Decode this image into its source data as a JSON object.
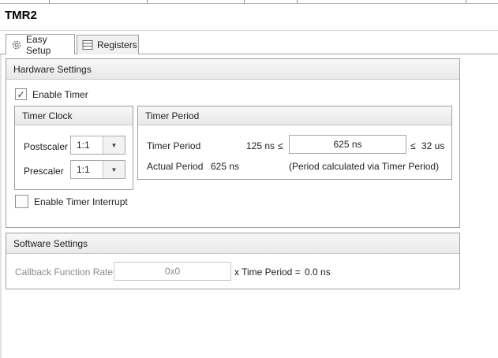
{
  "window": {
    "title": "TMR2"
  },
  "tabs": [
    {
      "label": "Easy Setup",
      "icon": "gear-icon",
      "active": true
    },
    {
      "label": "Registers",
      "icon": "register-table-icon",
      "active": false
    }
  ],
  "hardware": {
    "header": "Hardware Settings",
    "enable_timer": {
      "label": "Enable Timer",
      "checked": true,
      "mark": "✓"
    },
    "timer_clock": {
      "header": "Timer Clock",
      "postscaler": {
        "label": "Postscaler",
        "value": "1:1"
      },
      "prescaler": {
        "label": "Prescaler",
        "value": "1:1"
      }
    },
    "timer_period": {
      "header": "Timer Period",
      "label": "Timer Period",
      "min": "125 ns",
      "le_left": "≤",
      "value": "625 ns",
      "le_right": "≤",
      "max": "32 us",
      "actual_label": "Actual Period",
      "actual_value": "625 ns",
      "note": "(Period calculated via Timer Period)"
    },
    "enable_interrupt": {
      "label": "Enable Timer Interrupt",
      "checked": false
    }
  },
  "software": {
    "header": "Software Settings",
    "callback_label": "Callback Function Rate",
    "callback_value": "0x0",
    "suffix": "x Time Period =",
    "result": "0.0 ns"
  },
  "colors": {
    "border": "#a0a0a0",
    "header_bg": "#ececec",
    "disabled_text": "#8a8a8a"
  }
}
